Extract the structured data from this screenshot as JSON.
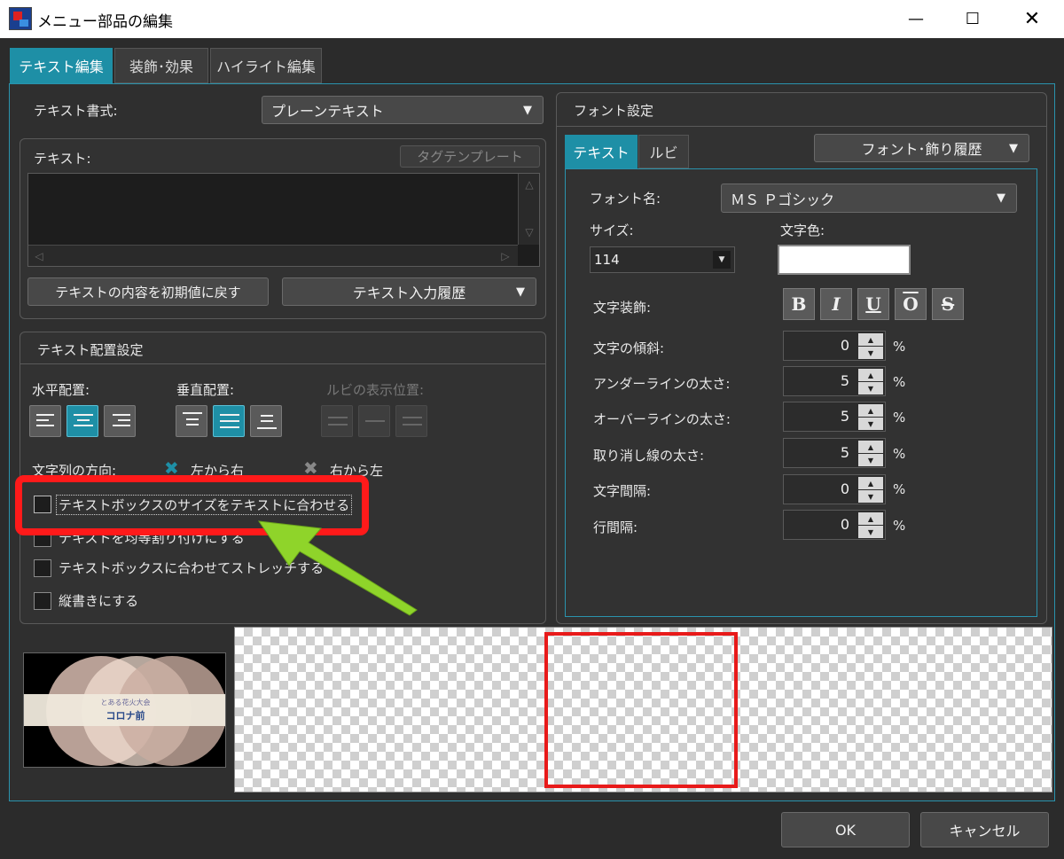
{
  "window": {
    "title": "メニュー部品の編集",
    "minimize_icon": "minimize-icon",
    "maximize_icon": "maximize-icon",
    "close_icon": "close-icon"
  },
  "tabs": [
    {
      "label": "テキスト編集",
      "active": true
    },
    {
      "label": "装飾･効果",
      "active": false
    },
    {
      "label": "ハイライト編集",
      "active": false
    }
  ],
  "text_format": {
    "label": "テキスト書式:",
    "value": "プレーンテキスト"
  },
  "text_panel": {
    "label": "テキスト:",
    "tag_template_button": "タグテンプレート",
    "content": "",
    "reset_button": "テキストの内容を初期値に戻す",
    "history_dropdown": "テキスト入力履歴"
  },
  "layout_panel": {
    "header": "テキスト配置設定",
    "horizontal_label": "水平配置:",
    "vertical_label": "垂直配置:",
    "ruby_label": "ルビの表示位置:",
    "direction_label": "文字列の方向:",
    "direction_options": [
      "左から右",
      "右から左"
    ],
    "checkboxes": [
      "テキストボックスのサイズをテキストに合わせる",
      "テキストを均等割り付けにする",
      "テキストボックスに合わせてストレッチする",
      "縦書きにする"
    ]
  },
  "font_panel": {
    "header": "フォント設定",
    "history_dropdown": "フォント･飾り履歴",
    "subtabs": [
      {
        "label": "テキスト",
        "active": true
      },
      {
        "label": "ルビ",
        "active": false
      }
    ],
    "font_name_label": "フォント名:",
    "font_name_value": "ＭＳ Ｐゴシック",
    "size_label": "サイズ:",
    "size_value": "114",
    "color_label": "文字色:",
    "color_value": "#ffffff",
    "decoration_label": "文字装飾:",
    "decoration_buttons": [
      "B",
      "I",
      "U",
      "O",
      "S"
    ],
    "spinners": [
      {
        "label": "文字の傾斜:",
        "value": "0",
        "unit": "%"
      },
      {
        "label": "アンダーラインの太さ:",
        "value": "5",
        "unit": "%"
      },
      {
        "label": "オーバーラインの太さ:",
        "value": "5",
        "unit": "%"
      },
      {
        "label": "取り消し線の太さ:",
        "value": "5",
        "unit": "%"
      },
      {
        "label": "文字間隔:",
        "value": "0",
        "unit": "%"
      },
      {
        "label": "行間隔:",
        "value": "0",
        "unit": "%"
      }
    ]
  },
  "thumbnail": {
    "line1": "とある花火大会",
    "line2": "コロナ前"
  },
  "footer": {
    "ok_button": "OK",
    "cancel_button": "キャンセル"
  },
  "colors": {
    "accent": "#1e8fa6",
    "highlight_red": "#ff1a1a",
    "arrow_green": "#8fd42a"
  }
}
